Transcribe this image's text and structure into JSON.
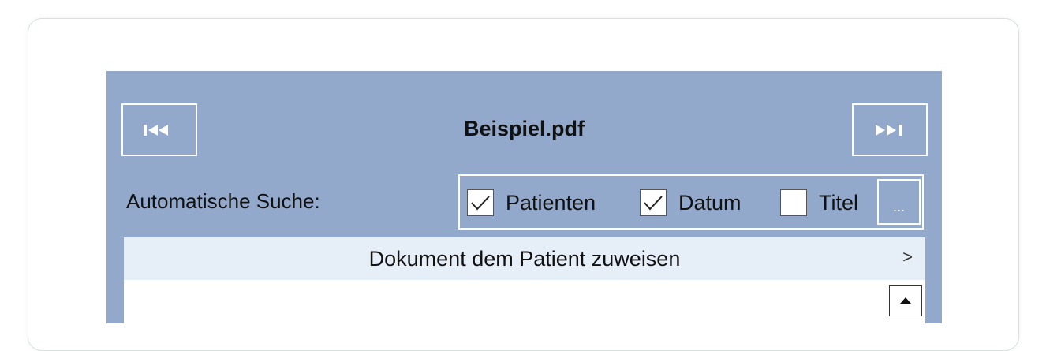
{
  "document": {
    "title": "Beispiel.pdf"
  },
  "navigation": {
    "first_icon": "skip-to-first-icon",
    "last_icon": "skip-to-last-icon"
  },
  "auto_search": {
    "label": "Automatische Suche:",
    "options": [
      {
        "label": "Patienten",
        "checked": true
      },
      {
        "label": "Datum",
        "checked": true
      },
      {
        "label": "Titel",
        "checked": false
      }
    ],
    "more_label": "..."
  },
  "assign": {
    "label": "Dokument dem Patient zuweisen",
    "chevron": ">"
  },
  "colors": {
    "panel": "#93a9cb",
    "assign_bar": "#e6eef8",
    "border": "#ffffff"
  }
}
